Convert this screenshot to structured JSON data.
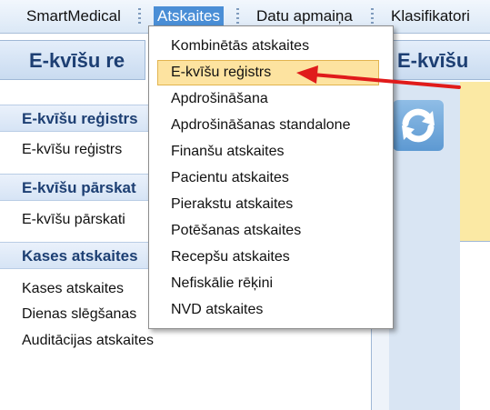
{
  "menubar": {
    "items": [
      "SmartMedical",
      "Atskaites",
      "Datu apmaiņa",
      "Klasifikatori"
    ],
    "active_index": 1
  },
  "left": {
    "header_title": "E-kvīšu re",
    "sections": [
      {
        "title": "E-kvīšu reģistrs",
        "links": [
          "E-kvīšu reģistrs"
        ]
      },
      {
        "title": "E-kvīšu pārskat",
        "links": [
          "E-kvīšu pārskati"
        ]
      },
      {
        "title": "Kases atskaites",
        "links": [
          "Kases atskaites",
          "Dienas slēgšanas",
          "Auditācijas atskaites"
        ]
      }
    ]
  },
  "right": {
    "header_title": "E-kvīšu",
    "refresh_icon": "refresh-icon"
  },
  "dropdown": {
    "items": [
      "Kombinētās atskaites",
      "E-kvīšu reģistrs",
      "Apdrošināšana",
      "Apdrošināšanas standalone",
      "Finanšu atskaites",
      "Pacientu atskaites",
      "Pierakstu atskaites",
      "Potēšanas atskaites",
      "Recepšu atskaites",
      "Nefiskālie rēķini",
      "NVD atskaites"
    ],
    "highlighted_index": 1
  },
  "colors": {
    "accent": "#4a8ed6",
    "header_text": "#1d3f73",
    "highlight": "#fde3a0",
    "arrow": "#e01b1b"
  }
}
